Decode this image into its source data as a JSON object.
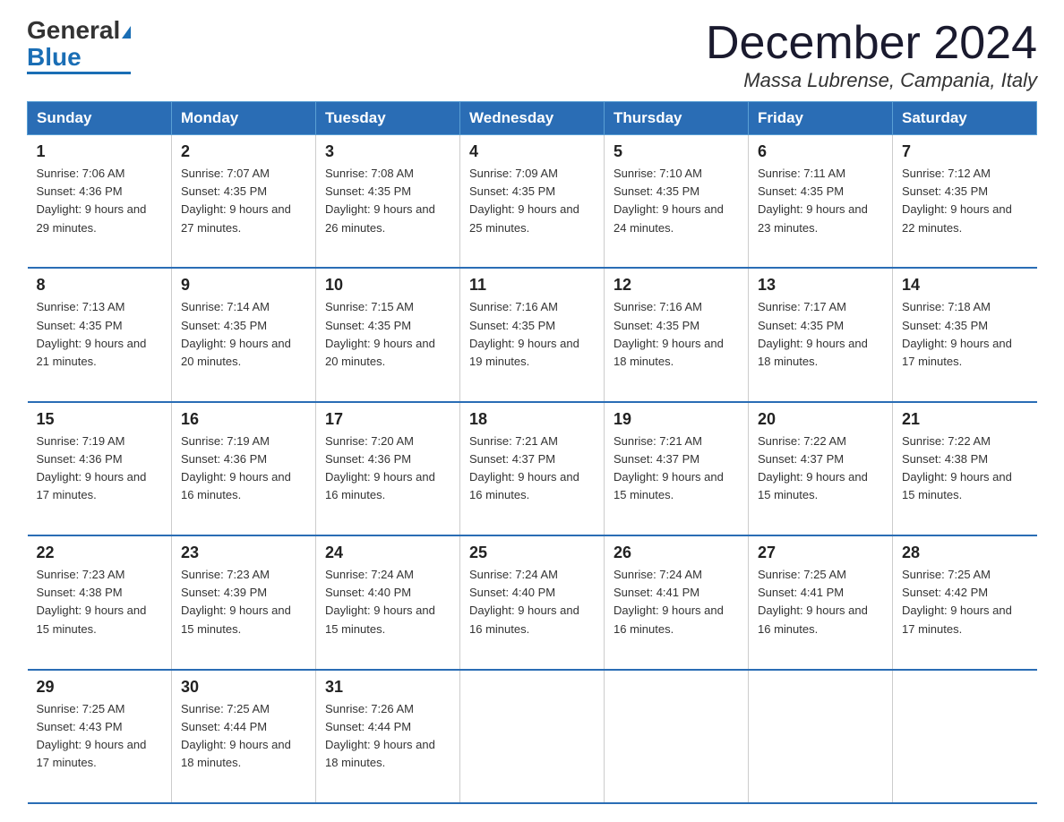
{
  "header": {
    "logo_general": "General",
    "logo_blue": "Blue",
    "month_title": "December 2024",
    "location": "Massa Lubrense, Campania, Italy"
  },
  "weekdays": [
    "Sunday",
    "Monday",
    "Tuesday",
    "Wednesday",
    "Thursday",
    "Friday",
    "Saturday"
  ],
  "weeks": [
    [
      {
        "day": "1",
        "sunrise": "7:06 AM",
        "sunset": "4:36 PM",
        "daylight": "9 hours and 29 minutes."
      },
      {
        "day": "2",
        "sunrise": "7:07 AM",
        "sunset": "4:35 PM",
        "daylight": "9 hours and 27 minutes."
      },
      {
        "day": "3",
        "sunrise": "7:08 AM",
        "sunset": "4:35 PM",
        "daylight": "9 hours and 26 minutes."
      },
      {
        "day": "4",
        "sunrise": "7:09 AM",
        "sunset": "4:35 PM",
        "daylight": "9 hours and 25 minutes."
      },
      {
        "day": "5",
        "sunrise": "7:10 AM",
        "sunset": "4:35 PM",
        "daylight": "9 hours and 24 minutes."
      },
      {
        "day": "6",
        "sunrise": "7:11 AM",
        "sunset": "4:35 PM",
        "daylight": "9 hours and 23 minutes."
      },
      {
        "day": "7",
        "sunrise": "7:12 AM",
        "sunset": "4:35 PM",
        "daylight": "9 hours and 22 minutes."
      }
    ],
    [
      {
        "day": "8",
        "sunrise": "7:13 AM",
        "sunset": "4:35 PM",
        "daylight": "9 hours and 21 minutes."
      },
      {
        "day": "9",
        "sunrise": "7:14 AM",
        "sunset": "4:35 PM",
        "daylight": "9 hours and 20 minutes."
      },
      {
        "day": "10",
        "sunrise": "7:15 AM",
        "sunset": "4:35 PM",
        "daylight": "9 hours and 20 minutes."
      },
      {
        "day": "11",
        "sunrise": "7:16 AM",
        "sunset": "4:35 PM",
        "daylight": "9 hours and 19 minutes."
      },
      {
        "day": "12",
        "sunrise": "7:16 AM",
        "sunset": "4:35 PM",
        "daylight": "9 hours and 18 minutes."
      },
      {
        "day": "13",
        "sunrise": "7:17 AM",
        "sunset": "4:35 PM",
        "daylight": "9 hours and 18 minutes."
      },
      {
        "day": "14",
        "sunrise": "7:18 AM",
        "sunset": "4:35 PM",
        "daylight": "9 hours and 17 minutes."
      }
    ],
    [
      {
        "day": "15",
        "sunrise": "7:19 AM",
        "sunset": "4:36 PM",
        "daylight": "9 hours and 17 minutes."
      },
      {
        "day": "16",
        "sunrise": "7:19 AM",
        "sunset": "4:36 PM",
        "daylight": "9 hours and 16 minutes."
      },
      {
        "day": "17",
        "sunrise": "7:20 AM",
        "sunset": "4:36 PM",
        "daylight": "9 hours and 16 minutes."
      },
      {
        "day": "18",
        "sunrise": "7:21 AM",
        "sunset": "4:37 PM",
        "daylight": "9 hours and 16 minutes."
      },
      {
        "day": "19",
        "sunrise": "7:21 AM",
        "sunset": "4:37 PM",
        "daylight": "9 hours and 15 minutes."
      },
      {
        "day": "20",
        "sunrise": "7:22 AM",
        "sunset": "4:37 PM",
        "daylight": "9 hours and 15 minutes."
      },
      {
        "day": "21",
        "sunrise": "7:22 AM",
        "sunset": "4:38 PM",
        "daylight": "9 hours and 15 minutes."
      }
    ],
    [
      {
        "day": "22",
        "sunrise": "7:23 AM",
        "sunset": "4:38 PM",
        "daylight": "9 hours and 15 minutes."
      },
      {
        "day": "23",
        "sunrise": "7:23 AM",
        "sunset": "4:39 PM",
        "daylight": "9 hours and 15 minutes."
      },
      {
        "day": "24",
        "sunrise": "7:24 AM",
        "sunset": "4:40 PM",
        "daylight": "9 hours and 15 minutes."
      },
      {
        "day": "25",
        "sunrise": "7:24 AM",
        "sunset": "4:40 PM",
        "daylight": "9 hours and 16 minutes."
      },
      {
        "day": "26",
        "sunrise": "7:24 AM",
        "sunset": "4:41 PM",
        "daylight": "9 hours and 16 minutes."
      },
      {
        "day": "27",
        "sunrise": "7:25 AM",
        "sunset": "4:41 PM",
        "daylight": "9 hours and 16 minutes."
      },
      {
        "day": "28",
        "sunrise": "7:25 AM",
        "sunset": "4:42 PM",
        "daylight": "9 hours and 17 minutes."
      }
    ],
    [
      {
        "day": "29",
        "sunrise": "7:25 AM",
        "sunset": "4:43 PM",
        "daylight": "9 hours and 17 minutes."
      },
      {
        "day": "30",
        "sunrise": "7:25 AM",
        "sunset": "4:44 PM",
        "daylight": "9 hours and 18 minutes."
      },
      {
        "day": "31",
        "sunrise": "7:26 AM",
        "sunset": "4:44 PM",
        "daylight": "9 hours and 18 minutes."
      },
      null,
      null,
      null,
      null
    ]
  ]
}
